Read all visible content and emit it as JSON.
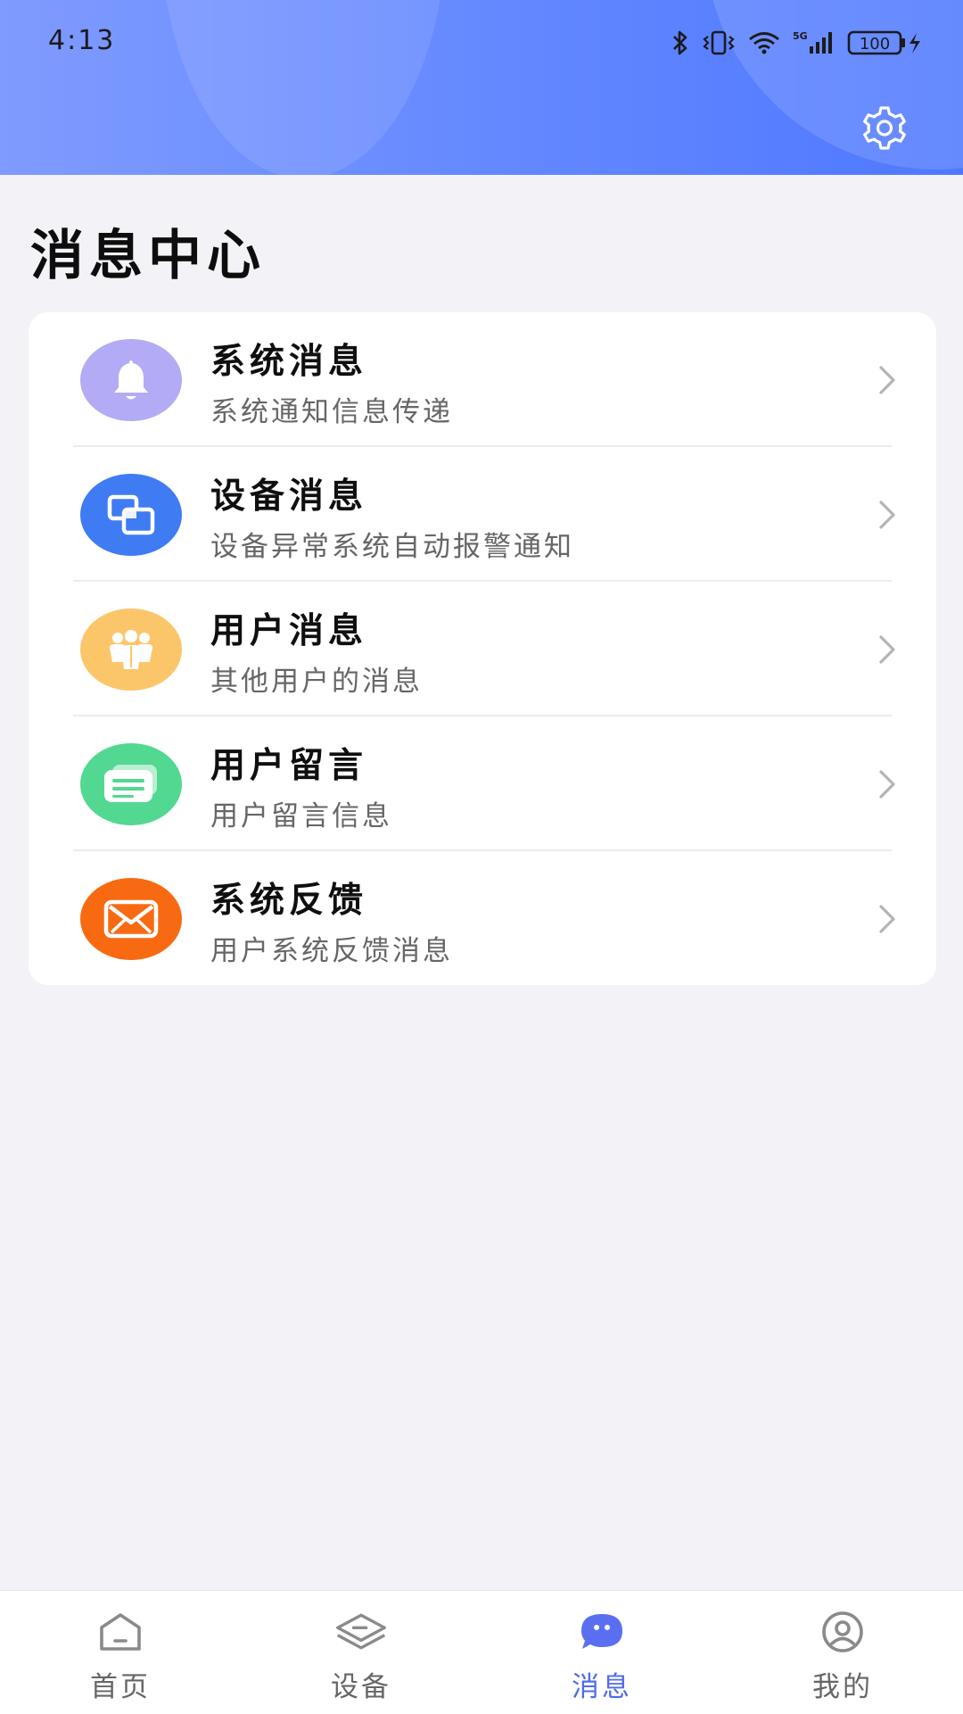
{
  "status_bar": {
    "time": "4:13",
    "network": "5G",
    "battery": "100"
  },
  "header": {
    "settings_icon": "gear-icon"
  },
  "page": {
    "title": "消息中心"
  },
  "messages": [
    {
      "title": "系统消息",
      "desc": "系统通知信息传递",
      "icon": "bell-icon",
      "color": "#b3abf6"
    },
    {
      "title": "设备消息",
      "desc": "设备异常系统自动报警通知",
      "icon": "device-icon",
      "color": "#3f7bf3"
    },
    {
      "title": "用户消息",
      "desc": "其他用户的消息",
      "icon": "users-icon",
      "color": "#fbc66a"
    },
    {
      "title": "用户留言",
      "desc": "用户留言信息",
      "icon": "chat-icon",
      "color": "#52d891"
    },
    {
      "title": "系统反馈",
      "desc": "用户系统反馈消息",
      "icon": "mail-icon",
      "color": "#f86a12"
    }
  ],
  "tabbar": {
    "active_color": "#4f6bed",
    "tabs": [
      {
        "label": "首页",
        "icon": "home-icon"
      },
      {
        "label": "设备",
        "icon": "layers-icon"
      },
      {
        "label": "消息",
        "icon": "message-icon",
        "active": true
      },
      {
        "label": "我的",
        "icon": "profile-icon"
      }
    ]
  }
}
